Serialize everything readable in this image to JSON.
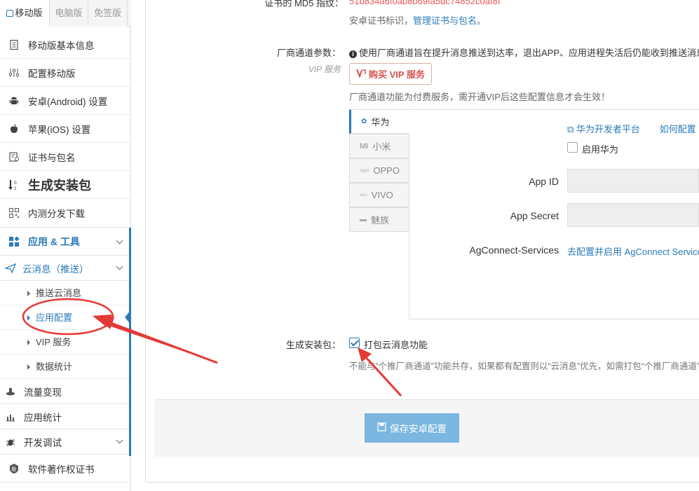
{
  "sidebar": {
    "top_tabs": [
      {
        "label": "移动版",
        "active": true
      },
      {
        "label": "电脑版",
        "active": false
      },
      {
        "label": "免签版",
        "active": false
      }
    ],
    "items": [
      {
        "label": "移动版基本信息",
        "icon": "document-icon"
      },
      {
        "label": "配置移动版",
        "icon": "sliders-icon"
      },
      {
        "label": "安卓(Android) 设置",
        "icon": "android-icon"
      },
      {
        "label": "苹果(iOS) 设置",
        "icon": "apple-icon"
      },
      {
        "label": "证书与包名",
        "icon": "certificate-icon"
      },
      {
        "label": "生成安装包",
        "icon": "sort-down-icon"
      },
      {
        "label": "内测分发下载",
        "icon": "qrcode-icon"
      },
      {
        "label": "应用 & 工具",
        "icon": "apps-icon"
      },
      {
        "label": "云消息（推送）",
        "icon": "paper-plane-icon"
      }
    ],
    "sub_items": [
      {
        "label": "推送云消息"
      },
      {
        "label": "应用配置",
        "active": true
      },
      {
        "label": "VIP 服务"
      },
      {
        "label": "数据统计"
      }
    ],
    "bottom_items": [
      {
        "label": "流量变现",
        "icon": "coins-icon"
      },
      {
        "label": "应用统计",
        "icon": "bar-chart-icon"
      },
      {
        "label": "开发调试",
        "icon": "bug-icon"
      },
      {
        "label": "软件著作权证书",
        "icon": "seal-icon"
      }
    ]
  },
  "main": {
    "md5": {
      "label": "证书的 MD5 指纹：",
      "value": "51b834a6f0ab8b69fa5dc74852c0af8f",
      "hint_prefix": "安卓证书标识，",
      "hint_link": "管理证书与包名",
      "hint_suffix": "。"
    },
    "vendor": {
      "label": "厂商通道参数：",
      "sublabel": "VIP 服务",
      "info": "使用厂商通道旨在提升消息推送到达率，退出APP、应用进程失活后仍能收到推送消息",
      "vip_button": "购买 VIP 服务",
      "vip_note": "厂商通道功能为付费服务，需开通VIP后这些配置信息才会生效！",
      "tabs": [
        {
          "label": "华为",
          "active": true
        },
        {
          "label": "小米"
        },
        {
          "label": "OPPO"
        },
        {
          "label": "VIVO"
        },
        {
          "label": "魅族"
        }
      ],
      "huawei": {
        "dev_link": "华为开发者平台",
        "howto_link": "如何配置",
        "enable_label": "启用华为",
        "app_id_label": "App ID",
        "app_id_value": "",
        "app_secret_label": "App Secret",
        "app_secret_value": "",
        "agconnect_label": "AgConnect-Services",
        "agconnect_link": "去配置并启用 AgConnect Services"
      }
    },
    "build": {
      "label": "生成安装包：",
      "checkbox_label": "打包云消息功能",
      "checked": true,
      "note": "不能与“个推厂商通道”功能共存，如果都有配置则以“云消息”优先，如需打包“个推厂商通道”"
    },
    "save_button": "保存安卓配置"
  },
  "colors": {
    "accent": "#2a7ab8",
    "annotation": "#e53935",
    "save_button": "#7bb7e0"
  }
}
